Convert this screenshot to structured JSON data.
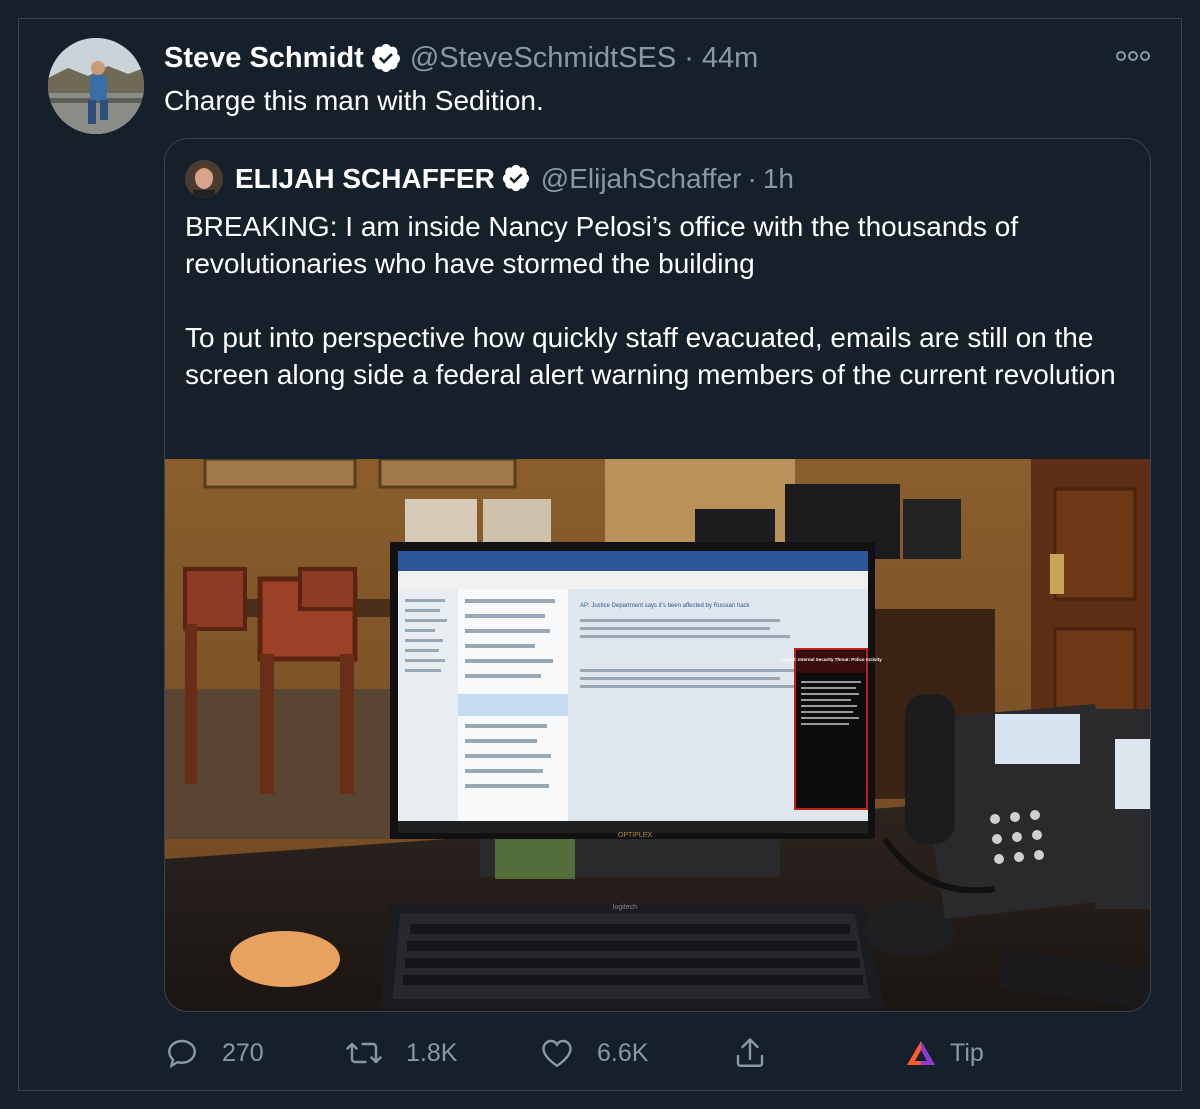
{
  "tweet": {
    "author_name": "Steve Schmidt",
    "handle": "@SteveSchmidtSES",
    "separator": "·",
    "time": "44m",
    "text": "Charge this man with Sedition."
  },
  "quoted_tweet": {
    "author_name": "ELIJAH SCHAFFER",
    "handle": "@ElijahSchaffer",
    "separator": "·",
    "time": "1h",
    "paragraph_1": "BREAKING: I am inside Nancy Pelosi’s office with the thousands of revolutionaries who have stormed the building",
    "paragraph_2": "To put into perspective how quickly staff evacuated, emails are still on the screen along side a federal alert warning members of the current revolution",
    "photo": {
      "screen_email_title": "AP: Justice Department says it’s been affected by Russian hack",
      "alert_title": "Capitol: Internal Security Threat: Police Activity",
      "monitor_brand": "OPTIPLEX",
      "keyboard_brand": "logitech"
    }
  },
  "actions": {
    "reply_count": "270",
    "retweet_count": "1.8K",
    "like_count": "6.6K",
    "tip_label": "Tip"
  },
  "icons": [
    "verified-badge-icon",
    "more-options-icon",
    "reply-icon",
    "retweet-icon",
    "like-icon",
    "share-icon",
    "tip-icon"
  ],
  "colors": {
    "background": "#15202b",
    "border": "#38444d",
    "secondary_text": "#8899a6",
    "verified": "#ffffff"
  }
}
